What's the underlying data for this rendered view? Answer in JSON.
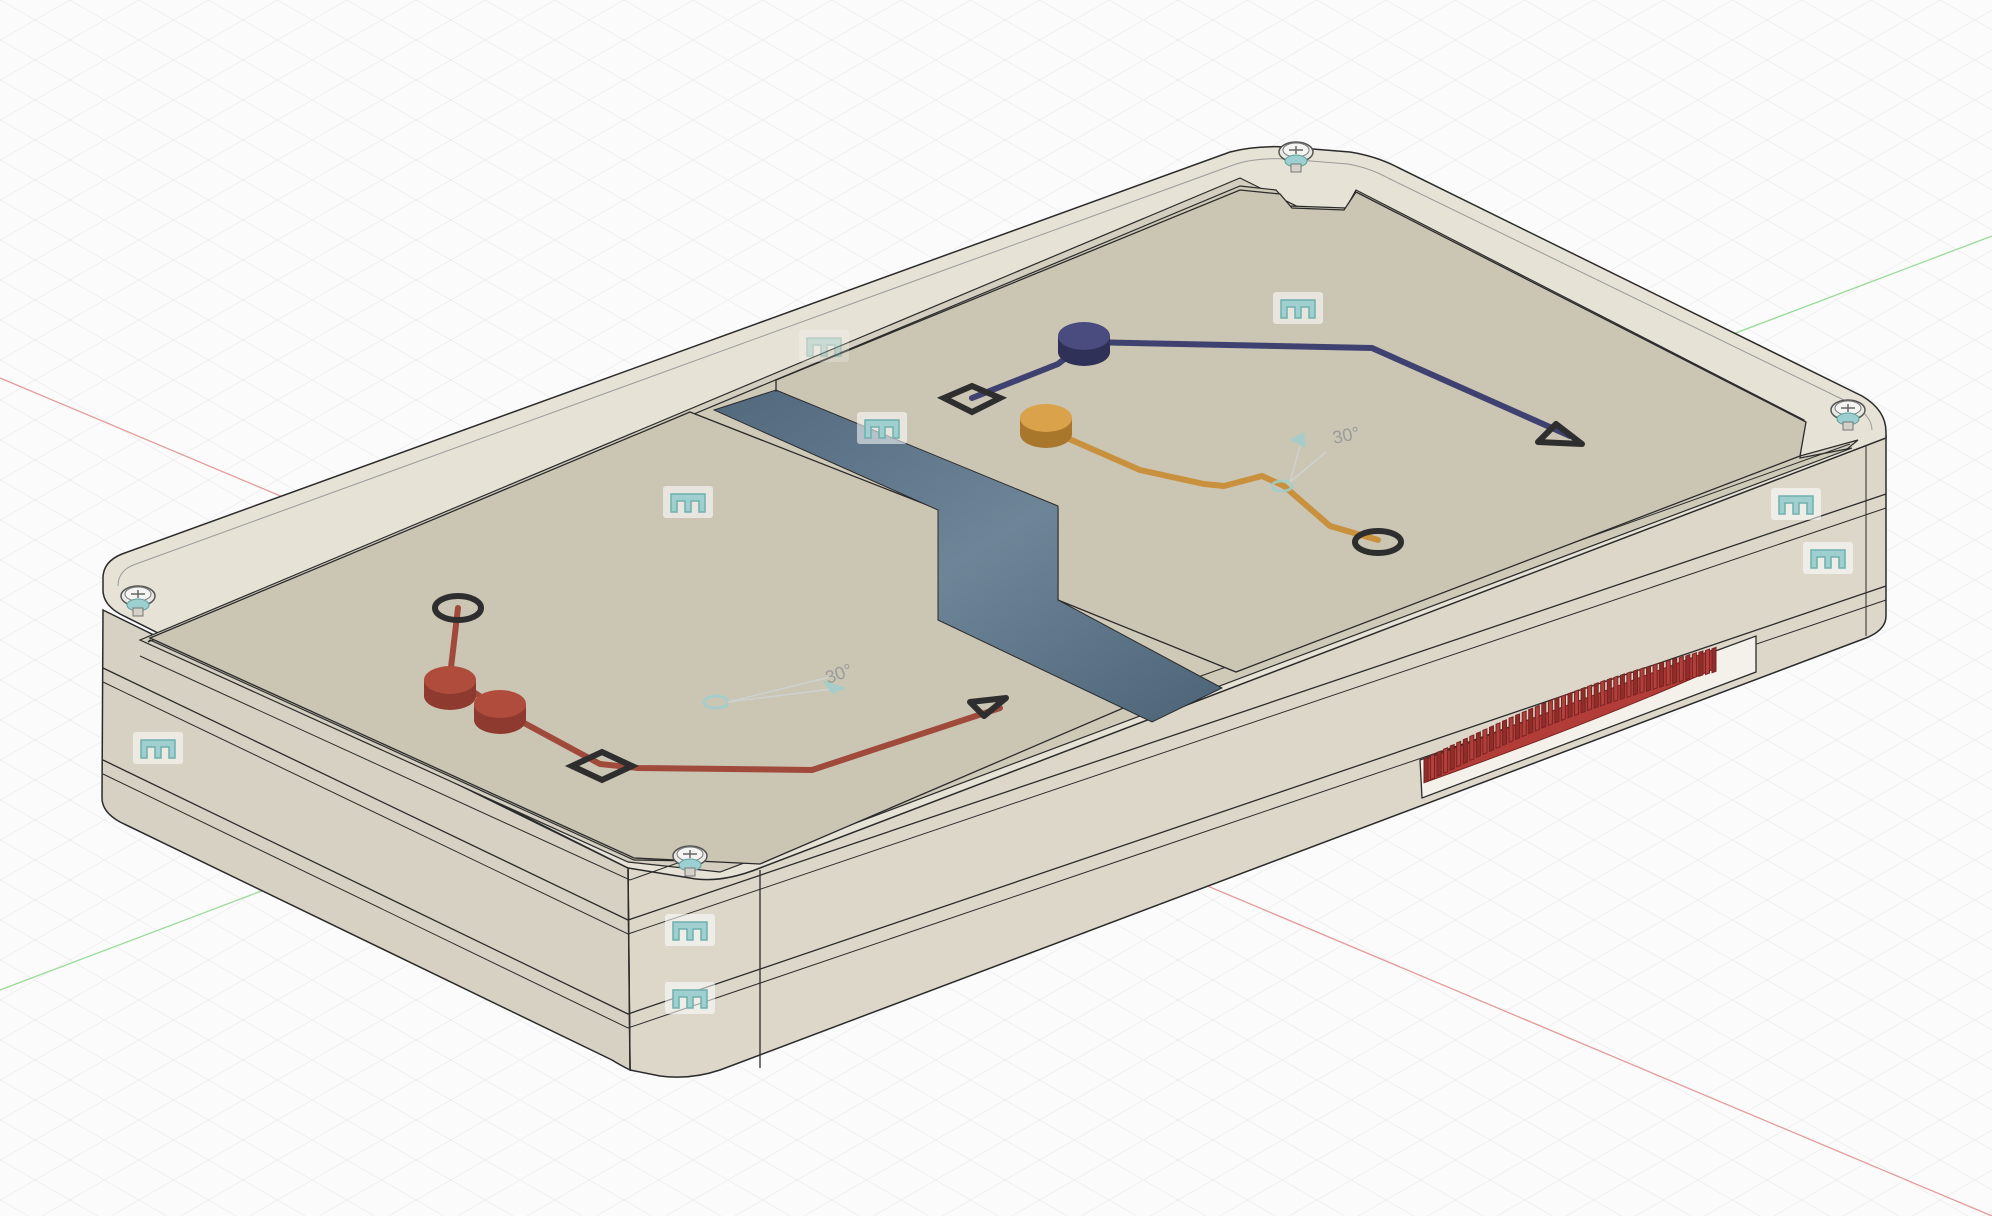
{
  "viewport": {
    "background_color": "#fbfbfb",
    "grid_color": "#e6e6e6",
    "x_axis_color": "#e38a8a",
    "y_axis_color": "#8fd68f"
  },
  "model": {
    "body_color": "#d9d4c6",
    "floor_color": "#cfcab8",
    "edge_color": "#2b2b2b",
    "channel_color": "#5b7286",
    "gear_color": "#b0413e"
  },
  "paths": {
    "left": {
      "color": "#a04a3c",
      "marker_color": "#2e2e2e",
      "dimension_label": "30°"
    },
    "upper": {
      "color": "#3f4170",
      "marker_color": "#2e2e2e"
    },
    "lower": {
      "color": "#c9913d",
      "marker_color": "#2e2e2e",
      "dimension_label": "30°"
    }
  },
  "icons": {
    "joint": "joint-icon",
    "screw": "screw-icon",
    "gear": "gear-icon"
  }
}
